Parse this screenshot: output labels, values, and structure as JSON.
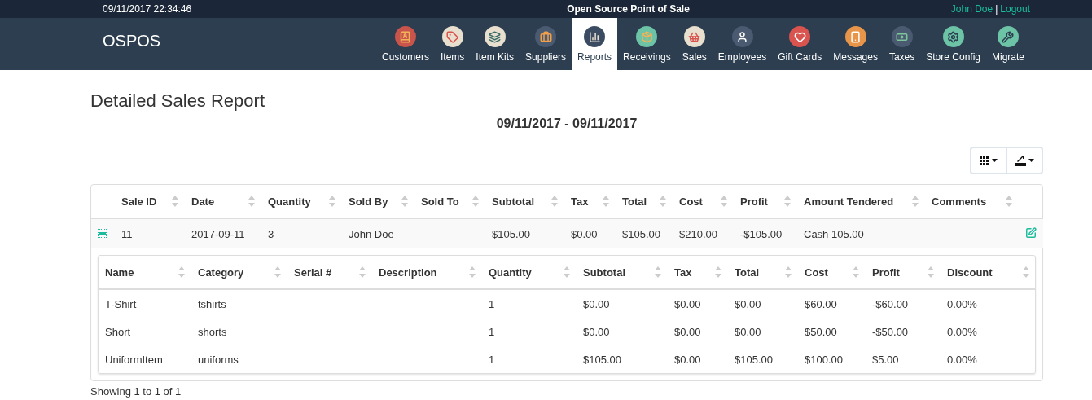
{
  "top_bar": {
    "datetime": "09/11/2017 22:34:46",
    "title": "Open Source Point of Sale",
    "user": "John Doe",
    "separator": "|",
    "logout": "Logout"
  },
  "nav": {
    "brand": "OSPOS",
    "items": [
      {
        "label": "Customers",
        "selected": false
      },
      {
        "label": "Items",
        "selected": false
      },
      {
        "label": "Item Kits",
        "selected": false
      },
      {
        "label": "Suppliers",
        "selected": false
      },
      {
        "label": "Reports",
        "selected": true
      },
      {
        "label": "Receivings",
        "selected": false
      },
      {
        "label": "Sales",
        "selected": false
      },
      {
        "label": "Employees",
        "selected": false
      },
      {
        "label": "Gift Cards",
        "selected": false
      },
      {
        "label": "Messages",
        "selected": false
      },
      {
        "label": "Taxes",
        "selected": false
      },
      {
        "label": "Store Config",
        "selected": false
      },
      {
        "label": "Migrate",
        "selected": false
      }
    ]
  },
  "report": {
    "title": "Detailed Sales Report",
    "date_range": "09/11/2017 - 09/11/2017"
  },
  "table": {
    "columns": [
      "Sale ID",
      "Date",
      "Quantity",
      "Sold By",
      "Sold To",
      "Subtotal",
      "Tax",
      "Total",
      "Cost",
      "Profit",
      "Amount Tendered",
      "Comments"
    ],
    "rows": [
      {
        "expanded": true,
        "cells": [
          "11",
          "2017-09-11",
          "3",
          "John Doe",
          "",
          "$105.00",
          "$0.00",
          "$105.00",
          "$210.00",
          "-$105.00",
          "Cash 105.00",
          ""
        ],
        "details": {
          "columns": [
            "Name",
            "Category",
            "Serial #",
            "Description",
            "Quantity",
            "Subtotal",
            "Tax",
            "Total",
            "Cost",
            "Profit",
            "Discount"
          ],
          "rows": [
            [
              "T-Shirt",
              "tshirts",
              "",
              "",
              "1",
              "$0.00",
              "$0.00",
              "$0.00",
              "$60.00",
              "-$60.00",
              "0.00%"
            ],
            [
              "Short",
              "shorts",
              "",
              "",
              "1",
              "$0.00",
              "$0.00",
              "$0.00",
              "$50.00",
              "-$50.00",
              "0.00%"
            ],
            [
              "UniformItem",
              "uniforms",
              "",
              "",
              "1",
              "$105.00",
              "$0.00",
              "$105.00",
              "$100.00",
              "$5.00",
              "0.00%"
            ]
          ]
        }
      }
    ]
  },
  "footer": "Showing 1 to 1 of 1"
}
